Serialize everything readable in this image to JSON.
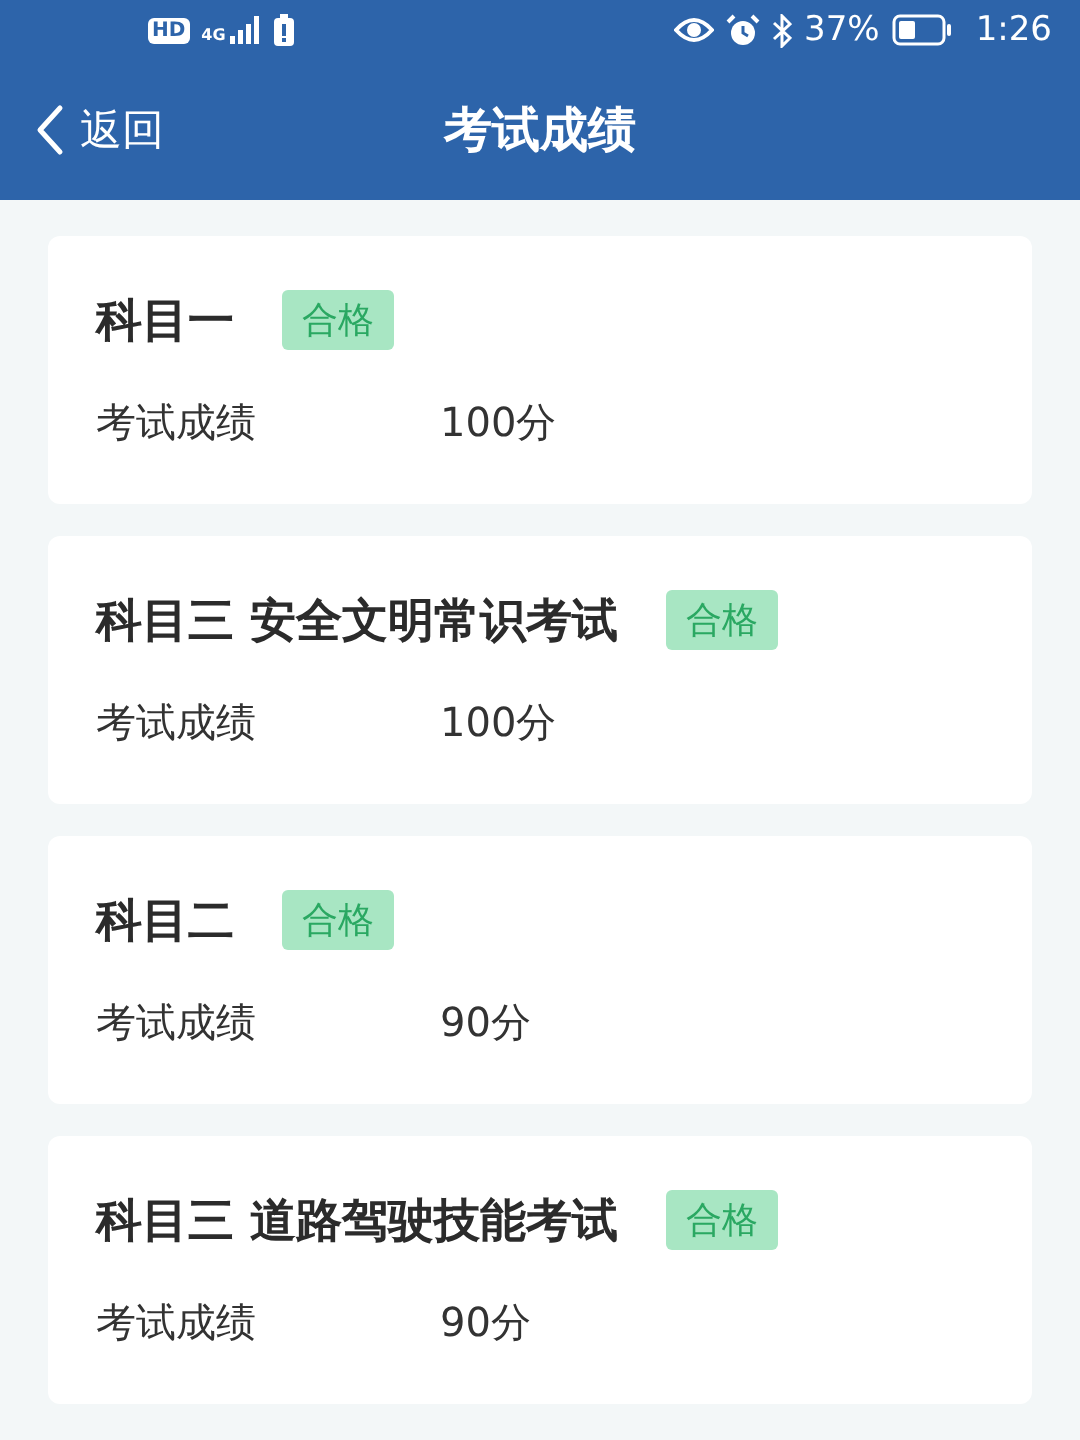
{
  "status_bar": {
    "hd": "HD",
    "network": "4G",
    "battery": "37%",
    "time": "1:26"
  },
  "nav": {
    "back": "返回",
    "title": "考试成绩"
  },
  "results": [
    {
      "subject": "科目一",
      "kind": "pass",
      "badge": "合格",
      "label": "考试成绩",
      "score": "100分"
    },
    {
      "subject": "科目三 安全文明常识考试",
      "kind": "pass",
      "badge": "合格",
      "label": "考试成绩",
      "score": "100分"
    },
    {
      "subject": "科目二",
      "kind": "pass",
      "badge": "合格",
      "label": "考试成绩",
      "score": "90分"
    },
    {
      "subject": "科目三 道路驾驶技能考试",
      "kind": "pass",
      "badge": "合格",
      "label": "考试成绩",
      "score": "90分"
    }
  ]
}
